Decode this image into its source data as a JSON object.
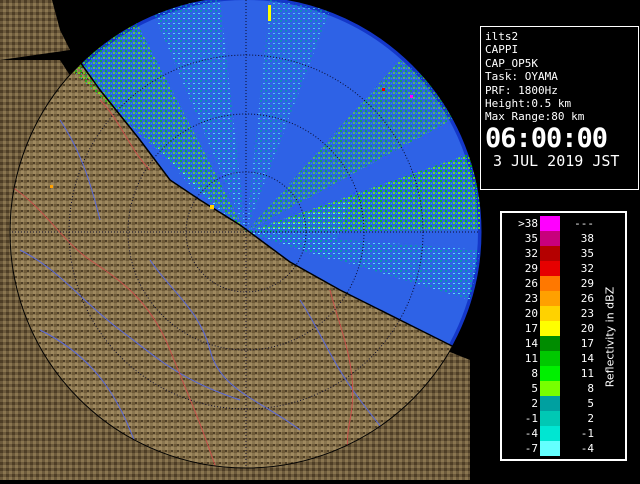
{
  "info": {
    "product_id": "ilts2",
    "product_type": "CAPPI",
    "product_name": "CAP_OP5K",
    "task": "Task: OYAMA",
    "prf": "PRF: 1800Hz",
    "height": "Height:0.5 km",
    "max_range": "Max Range:80 km",
    "time": "06:00:00",
    "date": "3 JUL 2019 JST"
  },
  "legend": {
    "title": "Reflectivity in dBZ",
    "rows": [
      {
        "lo": ">38",
        "hi": "---",
        "color": "#ff00ff"
      },
      {
        "lo": "35",
        "hi": "38",
        "color": "#c8007c"
      },
      {
        "lo": "32",
        "hi": "35",
        "color": "#b40000"
      },
      {
        "lo": "29",
        "hi": "32",
        "color": "#e60000"
      },
      {
        "lo": "26",
        "hi": "29",
        "color": "#ff7800"
      },
      {
        "lo": "23",
        "hi": "26",
        "color": "#ffa000"
      },
      {
        "lo": "20",
        "hi": "23",
        "color": "#ffd200"
      },
      {
        "lo": "17",
        "hi": "20",
        "color": "#ffff00"
      },
      {
        "lo": "14",
        "hi": "17",
        "color": "#008c00"
      },
      {
        "lo": "11",
        "hi": "14",
        "color": "#00c800"
      },
      {
        "lo": "8",
        "hi": "11",
        "color": "#00f000"
      },
      {
        "lo": "5",
        "hi": "8",
        "color": "#78ff00"
      },
      {
        "lo": "2",
        "hi": "5",
        "color": "#00a0a0"
      },
      {
        "lo": "-1",
        "hi": "2",
        "color": "#00c8b4"
      },
      {
        "lo": "-4",
        "hi": "-1",
        "color": "#00e6d2"
      },
      {
        "lo": "-7",
        "hi": "-4",
        "color": "#64ffff"
      }
    ]
  },
  "colors": {
    "sea": "#2e62e6",
    "sea_outer": "#1437c8",
    "land": "#8a7650",
    "land_dark": "#4e3e26",
    "river": "#5a6adc",
    "border": "#c8504a",
    "coast": "#000000",
    "range_ring": "#1a1a3a"
  }
}
